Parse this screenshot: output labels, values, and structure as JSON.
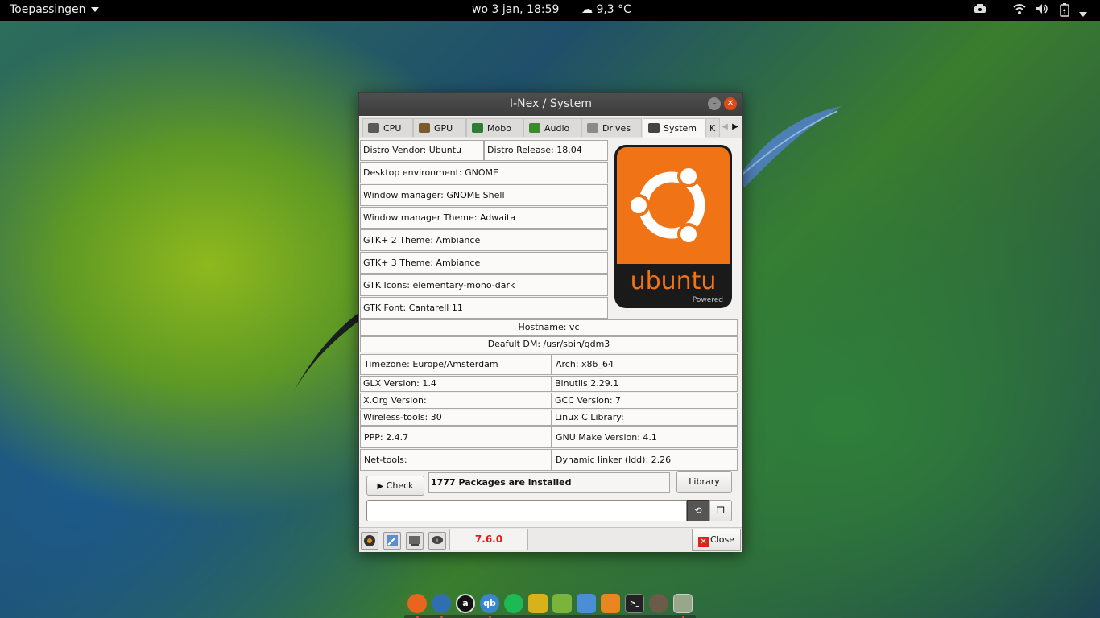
{
  "topbar": {
    "apps_label": "Toepassingen",
    "clock": "wo  3 jan, 18:59",
    "weather": "9,3 °C",
    "weather_icon": "cloud-rain-icon",
    "tray_icons": [
      "printer-icon",
      "wifi-icon",
      "volume-icon",
      "battery-icon",
      "menu-caret-icon"
    ]
  },
  "window": {
    "title": "I-Nex / System",
    "tabs": [
      {
        "label": "CPU",
        "icon": "cpu-icon",
        "color": "#555555"
      },
      {
        "label": "GPU",
        "icon": "gpu-icon",
        "color": "#7a5a2a"
      },
      {
        "label": "Mobo",
        "icon": "motherboard-icon",
        "color": "#2e7d32"
      },
      {
        "label": "Audio",
        "icon": "audio-icon",
        "color": "#3b8b2a"
      },
      {
        "label": "Drives",
        "icon": "drive-icon",
        "color": "#888888"
      },
      {
        "label": "System",
        "icon": "system-icon",
        "color": "#444444"
      },
      {
        "label": "K",
        "icon": "",
        "color": ""
      }
    ],
    "active_tab": "System",
    "fields": {
      "distro_vendor": "Distro Vendor: Ubuntu",
      "distro_release": "Distro Release: 18.04",
      "desktop_env": "Desktop environment: GNOME",
      "window_manager": "Window manager: GNOME Shell",
      "wm_theme": "Window manager Theme: Adwaita",
      "gtk2_theme": "GTK+ 2 Theme: Ambiance",
      "gtk3_theme": "GTK+ 3 Theme: Ambiance",
      "gtk_icons": "GTK Icons: elementary-mono-dark",
      "gtk_font": "GTK Font: Cantarell 11",
      "hostname": "Hostname: vc",
      "default_dm": "Deafult DM: /usr/sbin/gdm3",
      "timezone": "Timezone:  Europe/Amsterdam",
      "arch": "Arch: x86_64",
      "glx": "GLX Version:  1.4",
      "binutils": "Binutils 2.29.1",
      "xorg": "X.Org Version:",
      "gcc": "GCC Version: 7",
      "wireless": "Wireless-tools: 30",
      "libc": "Linux C Library:",
      "ppp": "PPP: 2.4.7",
      "make": "GNU Make Version: 4.1",
      "nettools": "Net-tools:",
      "ldd": "Dynamic linker (ldd): 2.26"
    },
    "logo": {
      "word": "ubuntu",
      "sub": "Powered",
      "bg": "#f07415"
    },
    "check_label": "Check",
    "packages": "1777 Packages are installed",
    "library_label": "Library",
    "command_value": "",
    "version": "7.6.0",
    "close_label": "Close"
  },
  "dock": {
    "apps": [
      {
        "name": "firefox",
        "text": "",
        "color": "#e8651f"
      },
      {
        "name": "thunderbird",
        "text": "",
        "color": "#2f6fb0"
      },
      {
        "name": "amazon",
        "text": "a",
        "color": "#111111"
      },
      {
        "name": "qbittorrent",
        "text": "qb",
        "color": "#3a87cf"
      },
      {
        "name": "spotify",
        "text": "",
        "color": "#1db954"
      },
      {
        "name": "app-yellow",
        "text": "",
        "color": "#d8b21a"
      },
      {
        "name": "rss",
        "text": "",
        "color": "#7bb43a"
      },
      {
        "name": "files",
        "text": "",
        "color": "#4a8fd6"
      },
      {
        "name": "settings",
        "text": "",
        "color": "#e8861f"
      },
      {
        "name": "terminal",
        "text": ">_",
        "color": "#222222"
      },
      {
        "name": "gimp",
        "text": "",
        "color": "#6b5b4a"
      },
      {
        "name": "i-nex",
        "text": "",
        "color": "#9aa68a"
      }
    ]
  }
}
